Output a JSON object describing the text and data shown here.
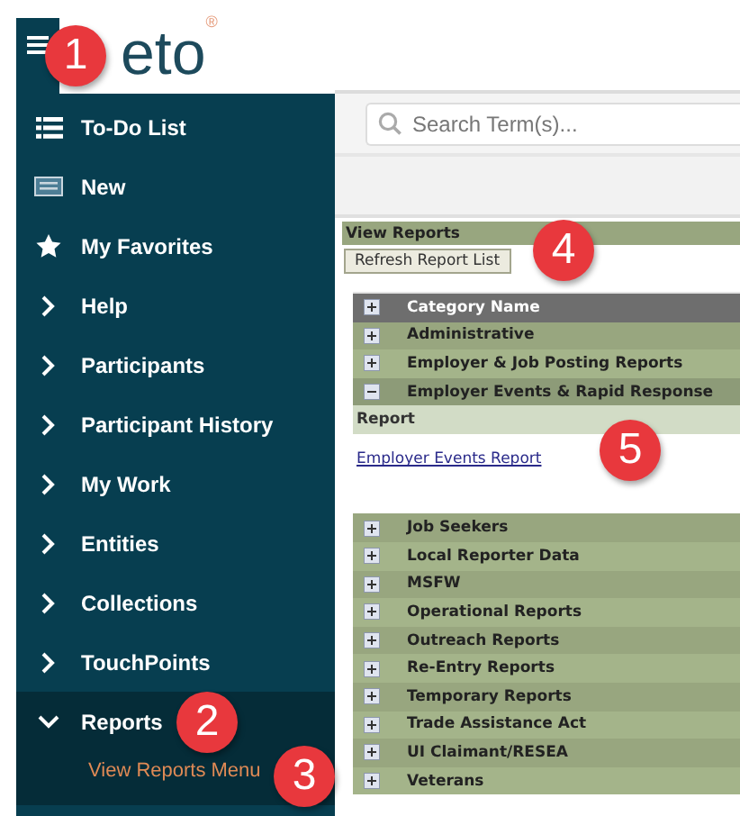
{
  "logo": {
    "text": "eto$^{®}$"
  },
  "sidebar": {
    "items": [
      {
        "label": "To-Do List",
        "kind": "list"
      },
      {
        "label": "New",
        "kind": "form"
      },
      {
        "label": "My Favorites",
        "kind": "star"
      },
      {
        "label": "Help",
        "kind": "group",
        "expanded": false
      },
      {
        "label": "Participants",
        "kind": "group",
        "expanded": false
      },
      {
        "label": "Participant History",
        "kind": "group",
        "expanded": false
      },
      {
        "label": "My Work",
        "kind": "group",
        "expanded": false
      },
      {
        "label": "Entities",
        "kind": "group",
        "expanded": false
      },
      {
        "label": "Collections",
        "kind": "group",
        "expanded": false
      },
      {
        "label": "TouchPoints",
        "kind": "group",
        "expanded": false
      },
      {
        "label": "Reports",
        "kind": "group",
        "expanded": true,
        "children": [
          {
            "label": "View Reports Menu"
          }
        ]
      }
    ]
  },
  "search": {
    "placeholder": "Search Term(s)..."
  },
  "view_reports": {
    "title": "View Reports",
    "refresh_button": "Refresh Report List",
    "table": {
      "header": "Category Name",
      "categories": [
        {
          "name": "Administrative",
          "expanded": false
        },
        {
          "name": "Employer & Job Posting Reports",
          "expanded": false
        },
        {
          "name": "Employer Events & Rapid Response",
          "expanded": true,
          "report_column": "Report",
          "reports": [
            "Employer Events Report"
          ]
        },
        {
          "name": "Job Seekers",
          "expanded": false
        },
        {
          "name": "Local Reporter Data",
          "expanded": false
        },
        {
          "name": "MSFW",
          "expanded": false
        },
        {
          "name": "Operational Reports",
          "expanded": false
        },
        {
          "name": "Outreach Reports",
          "expanded": false
        },
        {
          "name": "Re-Entry Reports",
          "expanded": false
        },
        {
          "name": "Temporary Reports",
          "expanded": false
        },
        {
          "name": "Trade Assistance Act",
          "expanded": false
        },
        {
          "name": "UI Claimant/RESEA",
          "expanded": false
        },
        {
          "name": "Veterans",
          "expanded": false
        }
      ]
    }
  },
  "callouts": [
    {
      "number": "1"
    },
    {
      "number": "2"
    },
    {
      "number": "3"
    },
    {
      "number": "4"
    },
    {
      "number": "5"
    }
  ]
}
